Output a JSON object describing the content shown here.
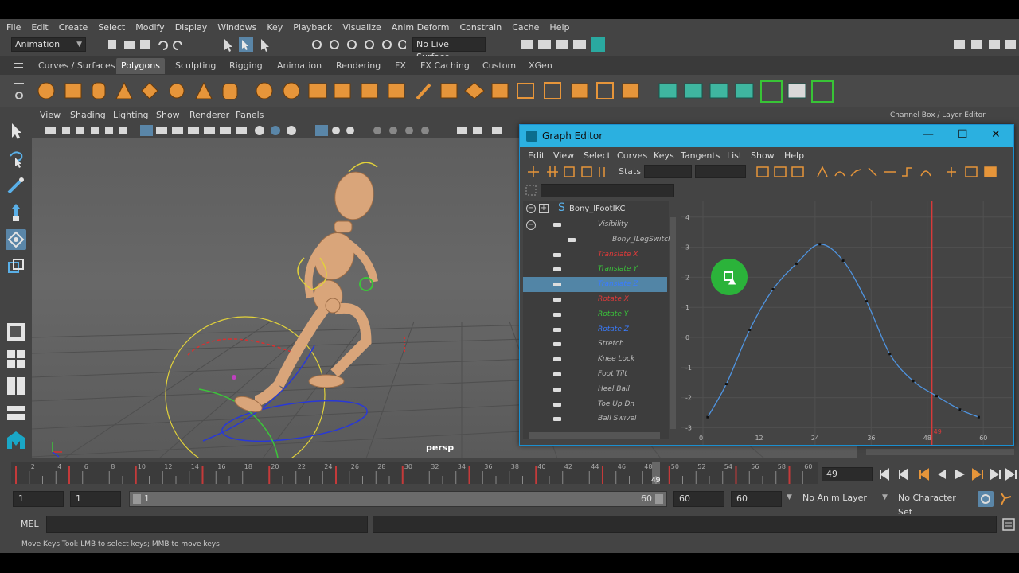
{
  "menubar": {
    "items": [
      "File",
      "Edit",
      "Create",
      "Select",
      "Modify",
      "Display",
      "Windows",
      "Key",
      "Playback",
      "Visualize",
      "Anim Deform",
      "Constrain",
      "Cache",
      "Help"
    ]
  },
  "statusline": {
    "mode": "Animation",
    "live_surface": "No Live Surface"
  },
  "shelf": {
    "tabs": [
      "Curves / Surfaces",
      "Polygons",
      "Sculpting",
      "Rigging",
      "Animation",
      "Rendering",
      "FX",
      "FX Caching",
      "Custom",
      "XGen"
    ],
    "active_tab": "Polygons"
  },
  "viewport": {
    "menu": [
      "View",
      "Shading",
      "Lighting",
      "Show",
      "Renderer",
      "Panels"
    ],
    "camera": "persp"
  },
  "channel_box": {
    "title": "Channel Box / Layer Editor"
  },
  "graph_editor": {
    "title": "Graph Editor",
    "menu": [
      "Edit",
      "View",
      "Select",
      "Curves",
      "Keys",
      "Tangents",
      "List",
      "Show",
      "Help"
    ],
    "stats_label": "Stats",
    "outliner": {
      "root": "Bony_lFootIKC",
      "items": [
        {
          "label": "Visibility",
          "color": "#bdbdbd"
        },
        {
          "label": "Bony_lLegSwitch",
          "color": "#bdbdbd"
        },
        {
          "label": "Translate X",
          "color": "#e03a3a"
        },
        {
          "label": "Translate Y",
          "color": "#39c43a"
        },
        {
          "label": "Translate Z",
          "color": "#3a7cff"
        },
        {
          "label": "Rotate X",
          "color": "#e03a3a"
        },
        {
          "label": "Rotate Y",
          "color": "#39c43a"
        },
        {
          "label": "Rotate Z",
          "color": "#3a7cff"
        },
        {
          "label": "Stretch",
          "color": "#bdbdbd"
        },
        {
          "label": "Knee Lock",
          "color": "#bdbdbd"
        },
        {
          "label": "Foot Tilt",
          "color": "#bdbdbd"
        },
        {
          "label": "Heel Ball",
          "color": "#bdbdbd"
        },
        {
          "label": "Toe Up Dn",
          "color": "#bdbdbd"
        },
        {
          "label": "Ball Swivel",
          "color": "#bdbdbd"
        }
      ],
      "selected": "Translate Z"
    },
    "graph": {
      "y_ticks": [
        "4",
        "3",
        "2",
        "1",
        "0",
        "-1",
        "-2",
        "-3"
      ],
      "x_ticks": [
        "0",
        "12",
        "24",
        "36",
        "48",
        "60"
      ],
      "current_frame_label": "49",
      "curve_color": "#4f94e0",
      "keys": [
        [
          1,
          -2.65
        ],
        [
          5,
          -1.55
        ],
        [
          10,
          0.25
        ],
        [
          15,
          1.6
        ],
        [
          20,
          2.45
        ],
        [
          25,
          3.1
        ],
        [
          30,
          2.55
        ],
        [
          35,
          1.2
        ],
        [
          40,
          -0.55
        ],
        [
          45,
          -1.45
        ],
        [
          50,
          -1.95
        ],
        [
          55,
          -2.4
        ],
        [
          59,
          -2.65
        ]
      ]
    }
  },
  "timeline": {
    "ticks": [
      "2",
      "4",
      "6",
      "8",
      "10",
      "12",
      "14",
      "16",
      "18",
      "20",
      "22",
      "24",
      "26",
      "28",
      "30",
      "32",
      "34",
      "36",
      "38",
      "40",
      "42",
      "44",
      "46",
      "48",
      "50",
      "52",
      "54",
      "56",
      "58",
      "60"
    ],
    "current": "49",
    "current_frame_field": "49"
  },
  "range": {
    "start": "1",
    "anim_start": "1",
    "range_left": "1",
    "range_right": "60",
    "anim_end": "60",
    "end": "60",
    "anim_layer": "No Anim Layer",
    "character_set": "No Character Set"
  },
  "command": {
    "lang": "MEL"
  },
  "help_line": "Move Keys Tool: LMB to select keys; MMB to move keys"
}
